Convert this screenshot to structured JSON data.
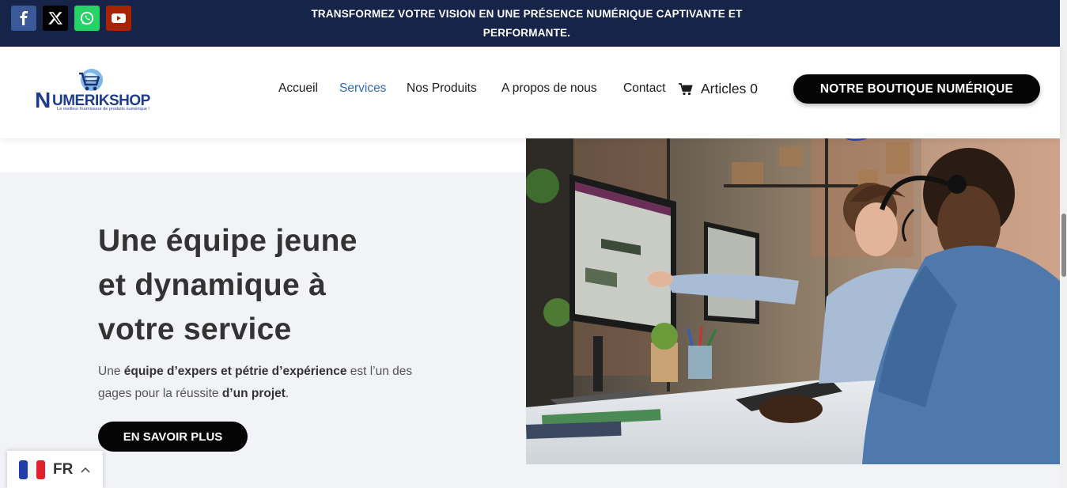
{
  "topbar": {
    "tagline_line1": "TRANSFORMEZ VOTRE VISION EN UNE PRÉSENCE NUMÉRIQUE CAPTIVANTE ET",
    "tagline_line2": "PERFORMANTE.",
    "social": [
      {
        "name": "facebook-icon",
        "color": "#3b5998"
      },
      {
        "name": "x-icon",
        "color": "#000000"
      },
      {
        "name": "whatsapp-icon",
        "color": "#25d366"
      },
      {
        "name": "youtube-icon",
        "color": "#a82400"
      }
    ]
  },
  "header": {
    "logo_text": "UMERIKSHOP",
    "logo_initial": "N",
    "logo_subtitle": "Le meilleur fournisseur de produits numérique !",
    "nav": [
      "Accueil",
      "Services",
      "Nos Produits",
      "A propos de nous",
      "Contact"
    ],
    "active_nav": "Services",
    "cart_label": "Articles 0",
    "shop_button": "NOTRE BOUTIQUE NUMÉRIQUE"
  },
  "hero": {
    "headline_l1": "Une équipe jeune",
    "headline_l2": "et dynamique à",
    "headline_l3": "votre service",
    "para_1": "Une ",
    "para_b1": "équipe d’expers et pétrie d’expérience",
    "para_2": " est l’un des gages pour la réussite ",
    "para_b2": "d’un projet",
    "para_3": ".",
    "cta": "EN SAVOIR PLUS"
  },
  "language": {
    "code": "FR"
  },
  "colors": {
    "topbar": "#16244a",
    "accent": "#2b6ab8",
    "button": "#050505"
  }
}
